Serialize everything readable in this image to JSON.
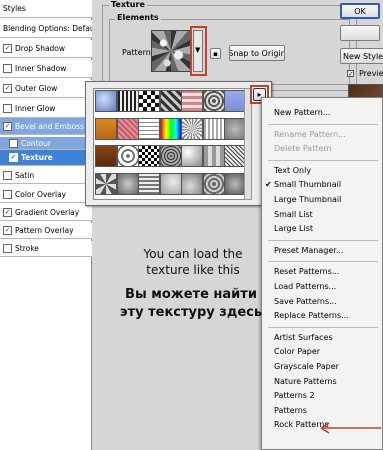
{
  "styles_panel": {
    "items": [
      {
        "label": "Styles",
        "checkbox": false,
        "checked": false,
        "state": "header"
      },
      {
        "label": "Blending Options: Default",
        "checkbox": false,
        "checked": false,
        "state": "normal"
      },
      {
        "label": "Drop Shadow",
        "checkbox": true,
        "checked": true,
        "state": "normal"
      },
      {
        "label": "Inner Shadow",
        "checkbox": true,
        "checked": false,
        "state": "normal"
      },
      {
        "label": "Outer Glow",
        "checkbox": true,
        "checked": true,
        "state": "normal"
      },
      {
        "label": "Inner Glow",
        "checkbox": true,
        "checked": false,
        "state": "normal"
      },
      {
        "label": "Bevel and Emboss",
        "checkbox": true,
        "checked": true,
        "state": "selected-light"
      },
      {
        "label": "Contour",
        "checkbox": true,
        "checked": false,
        "state": "selected-light",
        "indent": true
      },
      {
        "label": "Texture",
        "checkbox": true,
        "checked": true,
        "state": "selected",
        "indent": true
      },
      {
        "label": "Satin",
        "checkbox": true,
        "checked": false,
        "state": "normal"
      },
      {
        "label": "Color Overlay",
        "checkbox": true,
        "checked": false,
        "state": "normal"
      },
      {
        "label": "Gradient Overlay",
        "checkbox": true,
        "checked": true,
        "state": "normal"
      },
      {
        "label": "Pattern Overlay",
        "checkbox": true,
        "checked": true,
        "state": "normal"
      },
      {
        "label": "Stroke",
        "checkbox": true,
        "checked": false,
        "state": "normal"
      }
    ]
  },
  "texture_panel": {
    "title": "Texture",
    "elements_label": "Elements",
    "pattern_label": "Pattern:",
    "snap_button": "Snap to Origin"
  },
  "dialog_buttons": {
    "ok": "OK",
    "new_style": "New Style...",
    "preview": "Preview"
  },
  "pattern_menu": {
    "items": [
      {
        "label": "New Pattern...",
        "enabled": true
      },
      {
        "sep": true
      },
      {
        "label": "Rename Pattern...",
        "enabled": false
      },
      {
        "label": "Delete Pattern",
        "enabled": false
      },
      {
        "sep": true
      },
      {
        "label": "Text Only",
        "enabled": true
      },
      {
        "label": "Small Thumbnail",
        "enabled": true,
        "checked": true
      },
      {
        "label": "Large Thumbnail",
        "enabled": true
      },
      {
        "label": "Small List",
        "enabled": true
      },
      {
        "label": "Large List",
        "enabled": true
      },
      {
        "sep": true
      },
      {
        "label": "Preset Manager...",
        "enabled": true
      },
      {
        "sep": true
      },
      {
        "label": "Reset Patterns...",
        "enabled": true
      },
      {
        "label": "Load Patterns...",
        "enabled": true
      },
      {
        "label": "Save Patterns...",
        "enabled": true
      },
      {
        "label": "Replace Patterns...",
        "enabled": true
      },
      {
        "sep": true
      },
      {
        "label": "Artist Surfaces",
        "enabled": true
      },
      {
        "label": "Color Paper",
        "enabled": true
      },
      {
        "label": "Grayscale Paper",
        "enabled": true
      },
      {
        "label": "Nature Patterns",
        "enabled": true
      },
      {
        "label": "Patterns 2",
        "enabled": true
      },
      {
        "label": "Patterns",
        "enabled": true
      },
      {
        "label": "Rock Patterns",
        "enabled": true
      }
    ]
  },
  "annotation": {
    "english_line1": "You can load the",
    "english_line2": "texture like this",
    "russian_line1": "Вы можете найти",
    "russian_line2": "эту текстуру здесь"
  },
  "colors": {
    "highlight_box": "#c0442a",
    "selection_blue": "#3d82d6",
    "arrow": "#c0442a"
  }
}
